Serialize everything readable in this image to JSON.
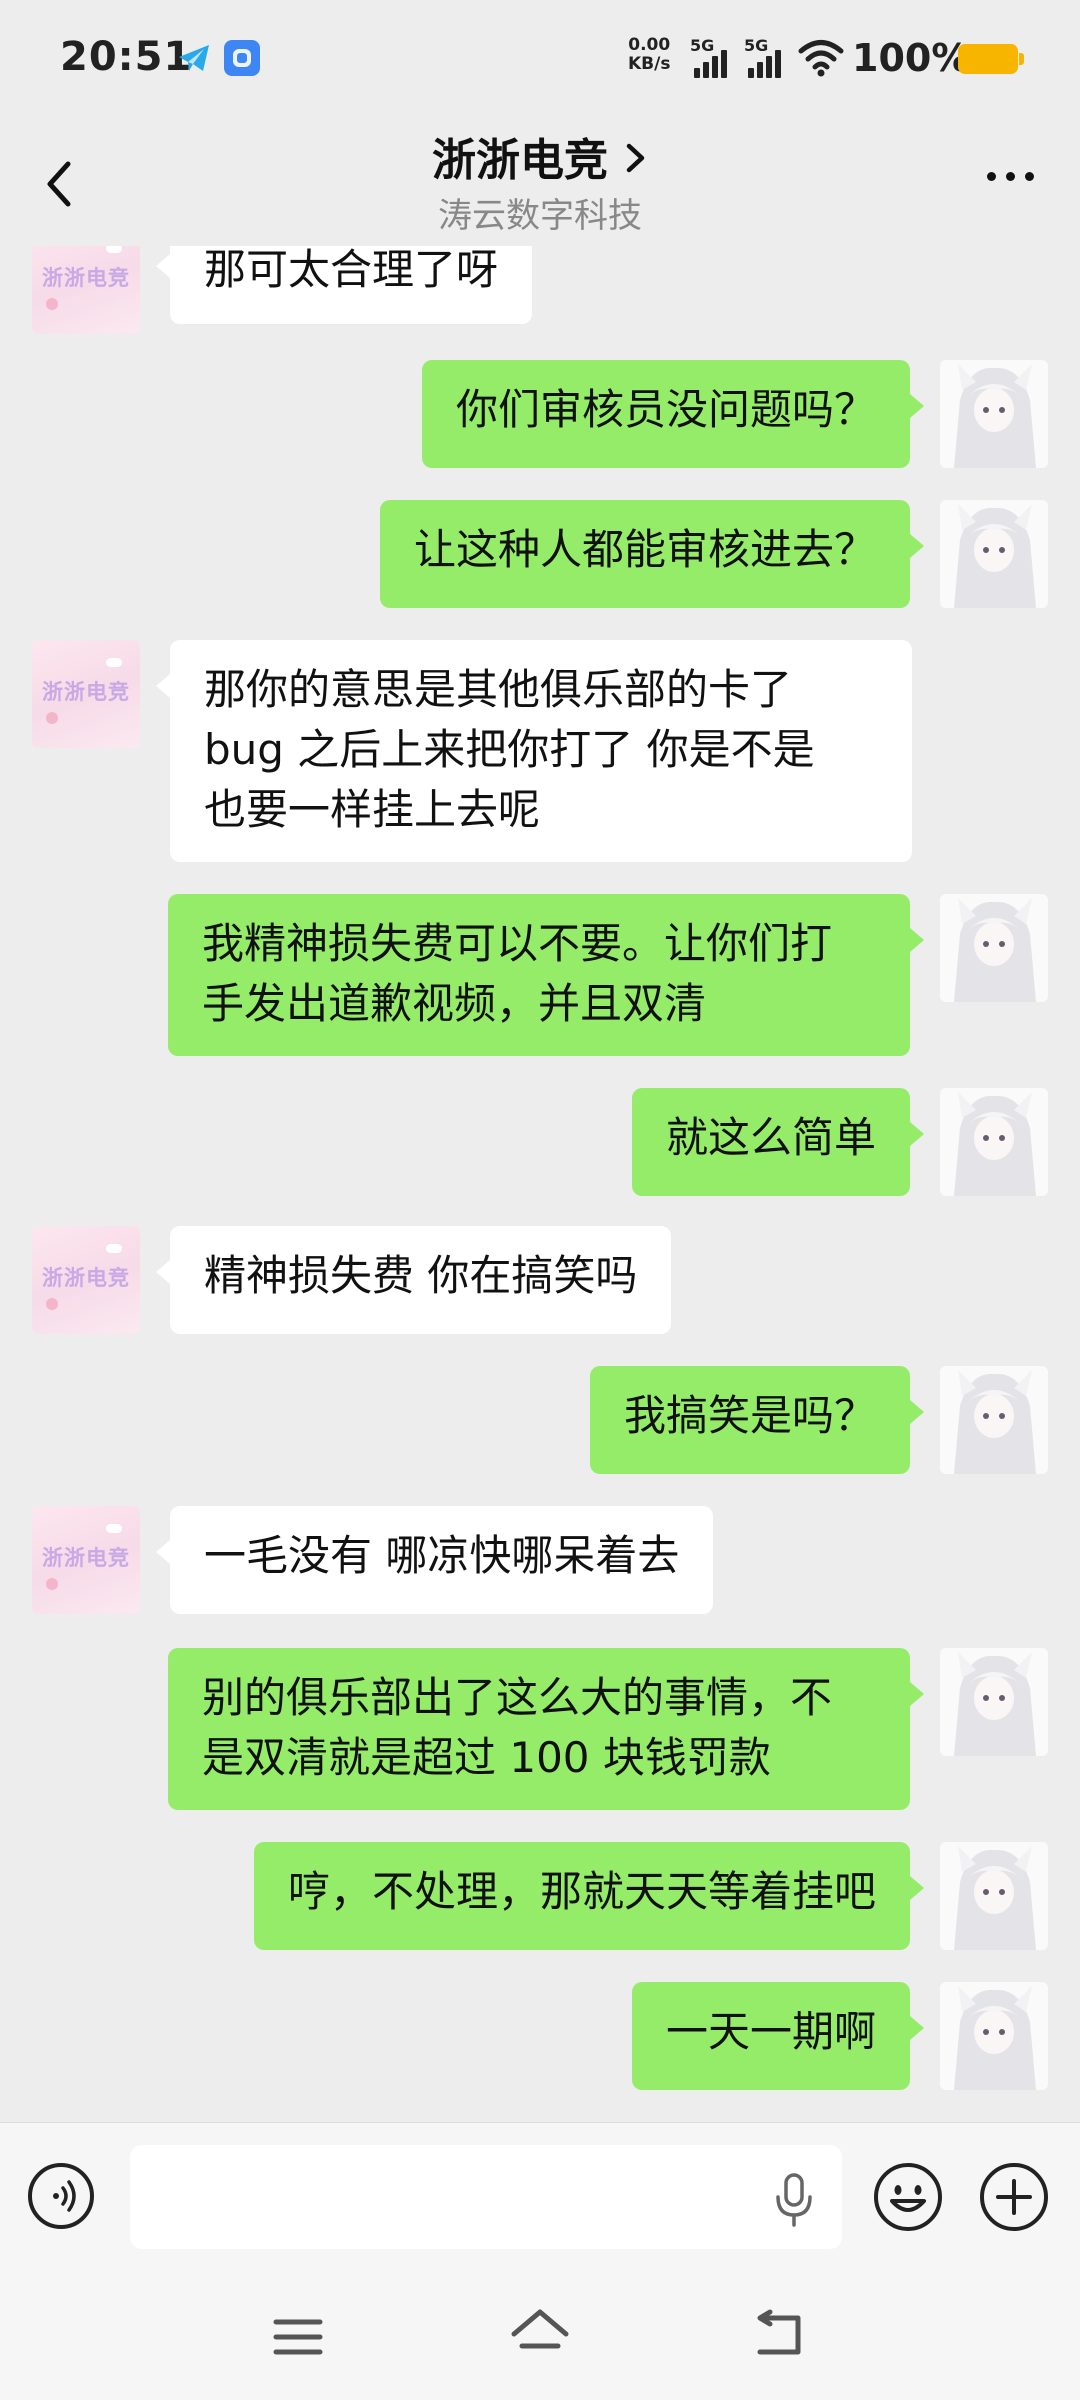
{
  "status_bar": {
    "time": "20:51",
    "net_speed_value": "0.00",
    "net_speed_unit": "KB/s",
    "sim1": "5G",
    "sim2": "5G",
    "battery": "100%",
    "battery_color": "#f7b500"
  },
  "header": {
    "title": "浙浙电竞",
    "subtitle": "涛云数字科技",
    "back_icon": "chevron-left-icon",
    "more_icon": "more-dots-icon"
  },
  "club_avatar_text": "浙浙电竞",
  "messages": [
    {
      "side": "in",
      "text": "那可太合理了呀"
    },
    {
      "side": "out",
      "text": "你们审核员没问题吗？"
    },
    {
      "side": "out",
      "text": "让这种人都能审核进去？"
    },
    {
      "side": "in",
      "text": "那你的意思是其他俱乐部的卡了\nbug 之后上来把你打了 你是不是\n也要一样挂上去呢"
    },
    {
      "side": "out",
      "text": "我精神损失费可以不要。让你们打\n手发出道歉视频，并且双清"
    },
    {
      "side": "out",
      "text": "就这么简单"
    },
    {
      "side": "in",
      "text": "精神损失费 你在搞笑吗"
    },
    {
      "side": "out",
      "text": "我搞笑是吗？"
    },
    {
      "side": "in",
      "text": "一毛没有 哪凉快哪呆着去"
    },
    {
      "side": "out",
      "text": "别的俱乐部出了这么大的事情，不\n是双清就是超过 100 块钱罚款"
    },
    {
      "side": "out",
      "text": "哼，不处理，那就天天等着挂吧"
    },
    {
      "side": "out",
      "text": "一天一期啊"
    }
  ],
  "input": {
    "value": "",
    "voice_icon": "voice-input-icon",
    "mic_icon": "microphone-icon",
    "emoji_icon": "emoji-icon",
    "plus_icon": "plus-icon"
  },
  "colors": {
    "outgoing_bubble": "#95ec69",
    "incoming_bubble": "#ffffff",
    "background": "#ededed"
  }
}
